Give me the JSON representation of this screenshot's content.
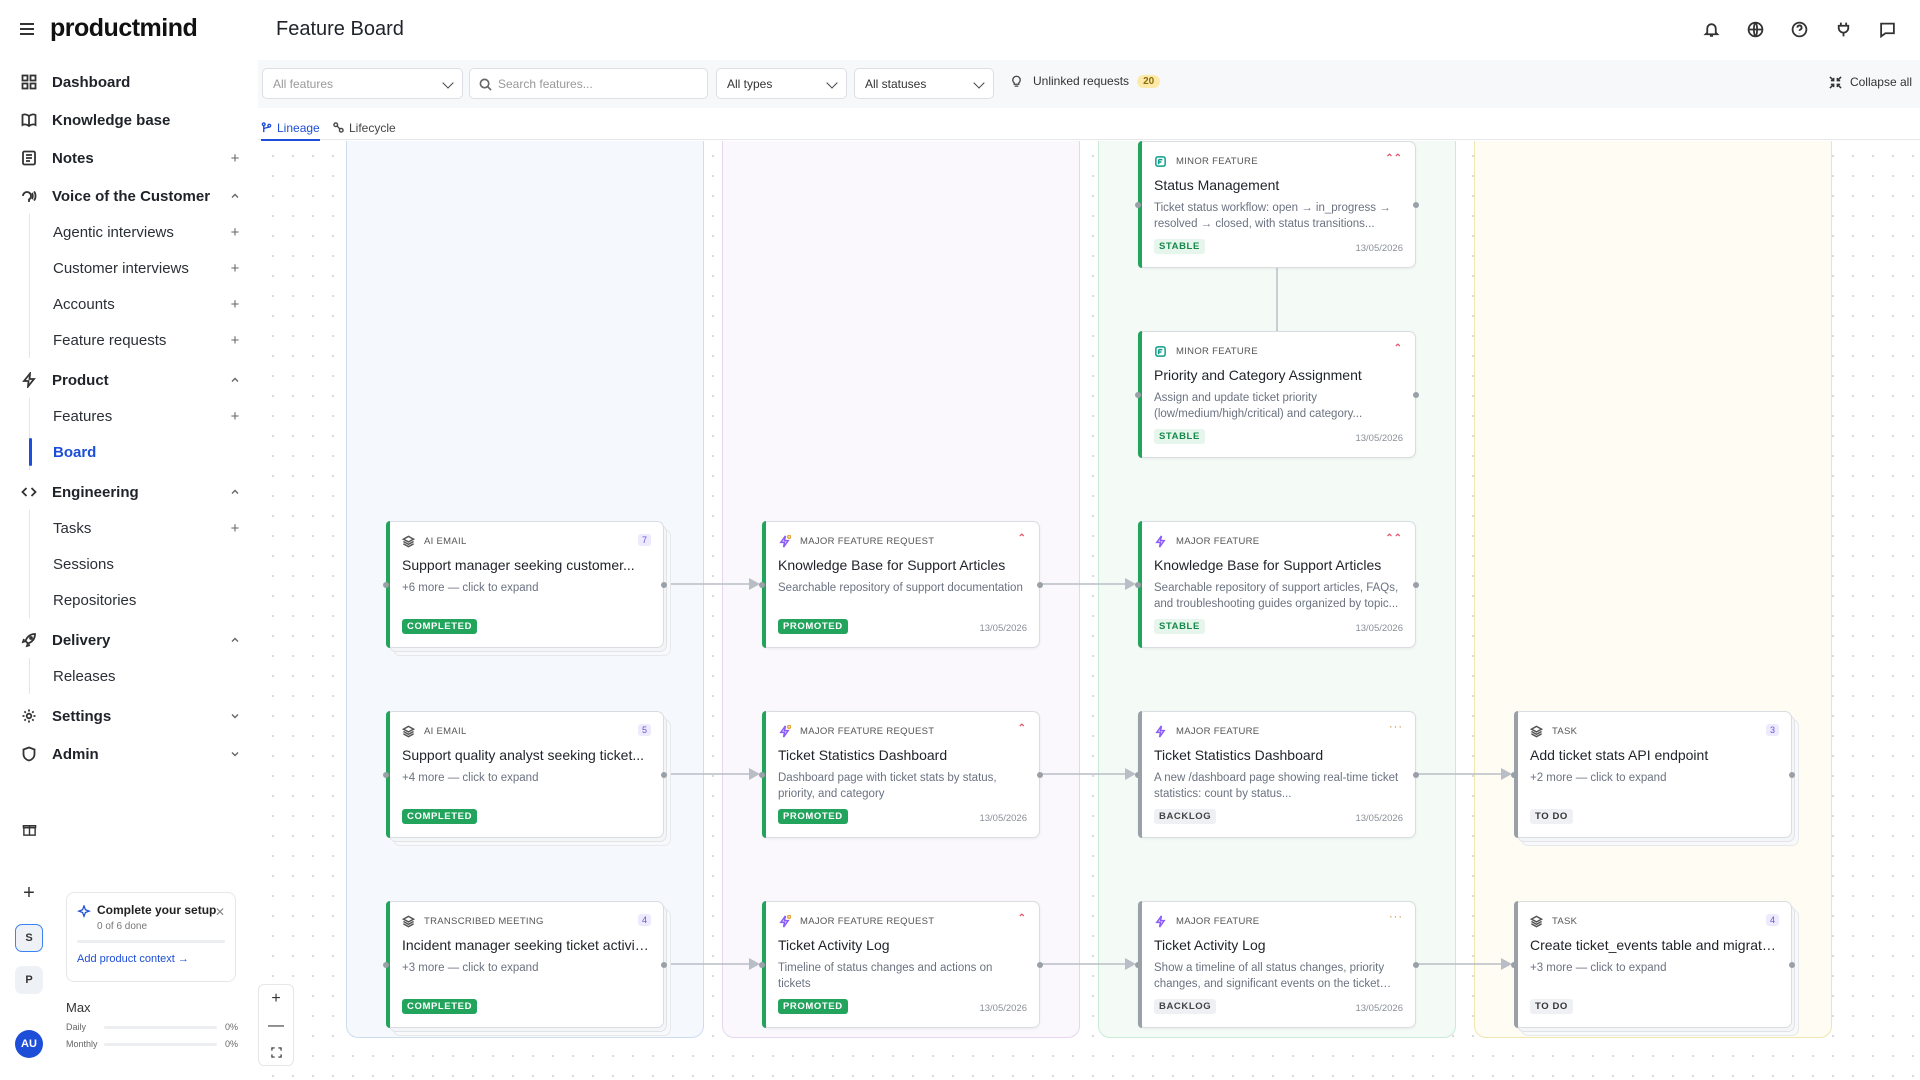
{
  "app": {
    "logo": "productmind"
  },
  "header": {
    "title": "Feature Board"
  },
  "sidebar": {
    "items": [
      {
        "label": "Dashboard",
        "icon": "dashboard-icon"
      },
      {
        "label": "Knowledge base",
        "icon": "book-icon"
      },
      {
        "label": "Notes",
        "icon": "notes-icon",
        "action": "+"
      },
      {
        "label": "Voice of the Customer",
        "icon": "voice-icon",
        "action": "^"
      },
      {
        "label": "Product",
        "icon": "bolt-icon",
        "action": "^"
      },
      {
        "label": "Engineering",
        "icon": "code-icon",
        "action": "^"
      },
      {
        "label": "Delivery",
        "icon": "rocket-icon",
        "action": "^"
      },
      {
        "label": "Settings",
        "icon": "gear-icon",
        "action": "v"
      },
      {
        "label": "Admin",
        "icon": "shield-icon",
        "action": "v"
      }
    ],
    "voc": [
      "Agentic interviews",
      "Customer interviews",
      "Accounts",
      "Feature requests"
    ],
    "product": [
      "Features",
      "Board"
    ],
    "engineering": [
      "Tasks",
      "Sessions",
      "Repositories"
    ],
    "delivery": [
      "Releases"
    ],
    "workspaces": [
      "S",
      "P"
    ],
    "user_initials": "AU"
  },
  "setup": {
    "title": "Complete your setup",
    "progress": "0 of 6 done",
    "progress_fraction": 0,
    "link": "Add product context →"
  },
  "plan": {
    "name": "Max",
    "daily_label": "Daily",
    "daily_value": "0%",
    "monthly_label": "Monthly",
    "monthly_value": "0%"
  },
  "toolbar": {
    "features_placeholder": "All features",
    "search_placeholder": "Search features...",
    "types": "All types",
    "statuses": "All statuses",
    "unlinked_label": "Unlinked requests",
    "unlinked_count": "20",
    "collapse_label": "Collapse all"
  },
  "tabs": [
    {
      "label": "Lineage"
    },
    {
      "label": "Lifecycle"
    }
  ],
  "lanes": [
    {
      "bg": "#f5f8fd",
      "border": "#cfdcf0"
    },
    {
      "bg": "#fbf8fd",
      "border": "#e6d6ee"
    },
    {
      "bg": "#f4fbf7",
      "border": "#c8ead6"
    },
    {
      "bg": "#fffdf3",
      "border": "#f1e5b1"
    }
  ],
  "colors": {
    "accent": "#1d4ed8",
    "green": "#22a45d",
    "purple": "#8b5cf6",
    "teal": "#0f9d8a"
  },
  "cards": [
    {
      "id": "sm",
      "lane": 2,
      "row": 0,
      "icon": "minor-feature-icon",
      "type": "MINOR FEATURE",
      "flag": "pri",
      "flag_text": "⌃⌃",
      "title": "Status Management",
      "desc": "Ticket status workflow: open → in_progress → resolved → closed, with status transitions...",
      "status": "STABLE",
      "status_class": "st-stable",
      "date": "13/05/2026",
      "accent": "#22a45d",
      "single": true
    },
    {
      "id": "pc",
      "lane": 2,
      "row": 1,
      "icon": "minor-feature-icon",
      "type": "MINOR FEATURE",
      "flag": "pri",
      "flag_text": "⌃",
      "title": "Priority and Category Assignment",
      "desc": "Assign and update ticket priority (low/medium/high/critical) and category...",
      "status": "STABLE",
      "status_class": "st-stable",
      "date": "13/05/2026",
      "accent": "#22a45d",
      "single": true
    },
    {
      "id": "e1",
      "lane": 0,
      "row": 2,
      "icon": "stack-icon",
      "type": "AI EMAIL",
      "flag": "cnt",
      "flag_text": "7",
      "title": "Support manager seeking customer...",
      "desc": "+6 more — click to expand",
      "status": "COMPLETED",
      "status_class": "st-completed",
      "date": "",
      "accent": "#22a45d",
      "single": false
    },
    {
      "id": "r1",
      "lane": 1,
      "row": 2,
      "icon": "request-icon",
      "type": "MAJOR FEATURE REQUEST",
      "flag": "pri",
      "flag_text": "⌃",
      "title": "Knowledge Base for Support Articles",
      "desc": "Searchable repository of support documentation",
      "status": "PROMOTED",
      "status_class": "st-promoted",
      "date": "13/05/2026",
      "accent": "#22a45d",
      "single": true
    },
    {
      "id": "f1",
      "lane": 2,
      "row": 2,
      "icon": "major-feature-icon",
      "type": "MAJOR FEATURE",
      "flag": "pri",
      "flag_text": "⌃⌃",
      "title": "Knowledge Base for Support Articles",
      "desc": "Searchable repository of support articles, FAQs, and troubleshooting guides organized by topic...",
      "status": "STABLE",
      "status_class": "st-stable",
      "date": "13/05/2026",
      "accent": "#22a45d",
      "single": true
    },
    {
      "id": "e2",
      "lane": 0,
      "row": 3,
      "icon": "stack-icon",
      "type": "AI EMAIL",
      "flag": "cnt",
      "flag_text": "5",
      "title": "Support quality analyst seeking ticket...",
      "desc": "+4 more — click to expand",
      "status": "COMPLETED",
      "status_class": "st-completed",
      "date": "",
      "accent": "#22a45d",
      "single": false
    },
    {
      "id": "r2",
      "lane": 1,
      "row": 3,
      "icon": "request-icon",
      "type": "MAJOR FEATURE REQUEST",
      "flag": "pri",
      "flag_text": "⌃",
      "title": "Ticket Statistics Dashboard",
      "desc": "Dashboard page with ticket stats by status, priority, and category",
      "status": "PROMOTED",
      "status_class": "st-promoted",
      "date": "13/05/2026",
      "accent": "#22a45d",
      "single": true
    },
    {
      "id": "f2",
      "lane": 2,
      "row": 3,
      "icon": "major-feature-icon",
      "type": "MAJOR FEATURE",
      "flag": "more",
      "flag_text": "···",
      "title": "Ticket Statistics Dashboard",
      "desc": "A new /dashboard page showing real-time ticket statistics: count by status...",
      "status": "BACKLOG",
      "status_class": "st-backlog",
      "date": "13/05/2026",
      "accent": "#9aa0a8",
      "single": true
    },
    {
      "id": "t1",
      "lane": 3,
      "row": 3,
      "icon": "stack-icon",
      "type": "TASK",
      "flag": "cnt",
      "flag_text": "3",
      "title": "Add ticket stats API endpoint",
      "desc": "+2 more — click to expand",
      "status": "TO DO",
      "status_class": "st-todo",
      "date": "",
      "accent": "#9aa0a8",
      "single": false
    },
    {
      "id": "e3",
      "lane": 0,
      "row": 4,
      "icon": "stack-icon",
      "type": "TRANSCRIBED MEETING",
      "flag": "cnt",
      "flag_text": "4",
      "title": "Incident manager seeking ticket activity...",
      "desc": "+3 more — click to expand",
      "status": "COMPLETED",
      "status_class": "st-completed",
      "date": "",
      "accent": "#22a45d",
      "single": false
    },
    {
      "id": "r3",
      "lane": 1,
      "row": 4,
      "icon": "request-icon",
      "type": "MAJOR FEATURE REQUEST",
      "flag": "pri",
      "flag_text": "⌃",
      "title": "Ticket Activity Log",
      "desc": "Timeline of status changes and actions on tickets",
      "status": "PROMOTED",
      "status_class": "st-promoted",
      "date": "13/05/2026",
      "accent": "#22a45d",
      "single": true
    },
    {
      "id": "f3",
      "lane": 2,
      "row": 4,
      "icon": "major-feature-icon",
      "type": "MAJOR FEATURE",
      "flag": "more",
      "flag_text": "···",
      "title": "Ticket Activity Log",
      "desc": "Show a timeline of all status changes, priority changes, and significant events on the ticket det...",
      "status": "BACKLOG",
      "status_class": "st-backlog",
      "date": "13/05/2026",
      "accent": "#9aa0a8",
      "single": true
    },
    {
      "id": "t2",
      "lane": 3,
      "row": 4,
      "icon": "stack-icon",
      "type": "TASK",
      "flag": "cnt",
      "flag_text": "4",
      "title": "Create ticket_events table and migration",
      "desc": "+3 more — click to expand",
      "status": "TO DO",
      "status_class": "st-todo",
      "date": "",
      "accent": "#9aa0a8",
      "single": false
    }
  ],
  "edges": [
    [
      "e1",
      "r1"
    ],
    [
      "r1",
      "f1"
    ],
    [
      "e2",
      "r2"
    ],
    [
      "r2",
      "f2"
    ],
    [
      "f2",
      "t1"
    ],
    [
      "e3",
      "r3"
    ],
    [
      "r3",
      "f3"
    ],
    [
      "f3",
      "t2"
    ]
  ],
  "vertical_edges": [
    [
      "sm",
      "pc"
    ]
  ]
}
